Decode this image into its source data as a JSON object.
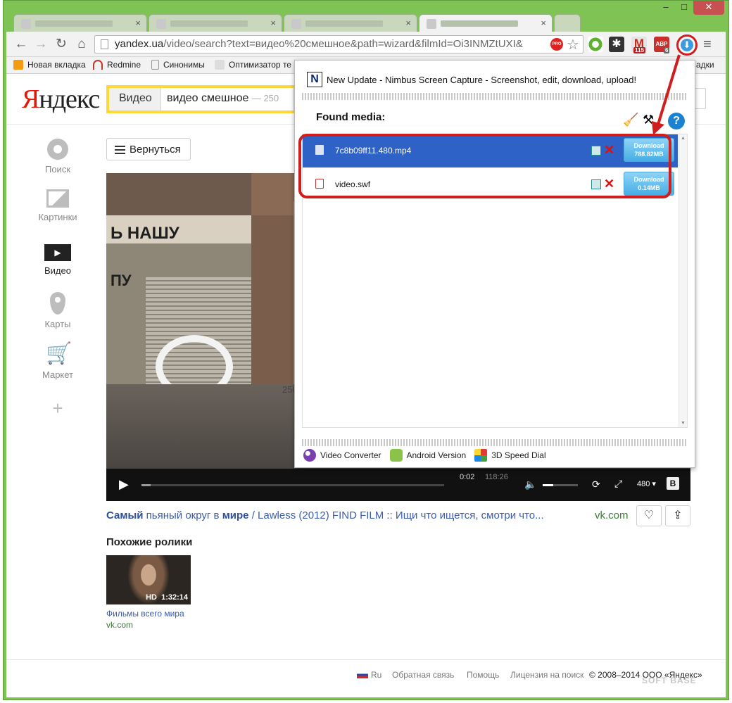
{
  "browser": {
    "omnibox": {
      "host": "yandex.ua",
      "path": "/video/search?text=видео%20смешное&path=wizard&filmId=Oi3INMZtUXI&"
    },
    "pro_badge": "PRO",
    "ext_badges": {
      "gmail": "115",
      "abp": "ABP",
      "abp_count": "6"
    },
    "bookmarks": [
      {
        "label": "Новая вкладка",
        "icon": "tab-icon"
      },
      {
        "label": "Redmine",
        "icon": "redmine-icon"
      },
      {
        "label": "Синонимы",
        "icon": "page-icon"
      },
      {
        "label": "Оптимизатор те",
        "icon": "seo-icon"
      }
    ],
    "bookmarks_overflow": "адки"
  },
  "yandex": {
    "logo_first": "Я",
    "logo_rest": "ндекс",
    "search_category": "Видео",
    "search_query": "видео смешное",
    "search_count": "— 250",
    "nav": [
      {
        "label": "Поиск",
        "icon": "search-circle-icon"
      },
      {
        "label": "Картинки",
        "icon": "pictures-icon"
      },
      {
        "label": "Видео",
        "icon": "video-play-icon"
      },
      {
        "label": "Карты",
        "icon": "map-pin-icon"
      },
      {
        "label": "Маркет",
        "icon": "cart-icon"
      }
    ],
    "nav_add": "+",
    "back_button": "Вернуться",
    "player": {
      "sign_text": "Ь НАШУ",
      "sign_text2": "ПУ",
      "sign_side": "250 ты",
      "time_current": "0:02",
      "time_total": "118:26",
      "quality": "480 ▾",
      "vk_badge": "B"
    },
    "video_title_parts": [
      {
        "text": "Самый",
        "bold": true
      },
      {
        "text": " пьяный округ в ",
        "bold": false
      },
      {
        "text": "мире",
        "bold": true
      },
      {
        "text": " / Lawless (2012) FIND FILM :: Ищи что ищется, смотри что...",
        "bold": false
      }
    ],
    "video_source": "vk.com",
    "similar_heading": "Похожие ролики",
    "similar": [
      {
        "hd": "HD",
        "duration": "1:32:14",
        "title": "Фильмы всего мира",
        "source": "vk.com"
      }
    ],
    "footer": {
      "lang": "Ru",
      "feedback": "Обратная связь",
      "help": "Помощь",
      "license": "Лицензия на поиск",
      "copyright": "© 2008–2014  ООО «Яндекс»"
    }
  },
  "popup": {
    "update_text": "New Update - Nimbus Screen Capture - Screenshot, edit, download, upload!",
    "found_label": "Found media:",
    "help_label": "?",
    "items": [
      {
        "name": "7c8b09ff11.480.mp4",
        "download": "Download",
        "size": "788.82MB",
        "selected": true
      },
      {
        "name": "video.swf",
        "download": "Download",
        "size": "0.14MB",
        "selected": false
      }
    ],
    "footer_links": [
      {
        "label": "Video Converter",
        "icon": "video-converter-icon"
      },
      {
        "label": "Android Version",
        "icon": "android-icon"
      },
      {
        "label": "3D Speed Dial",
        "icon": "speed-dial-icon"
      }
    ]
  },
  "watermark": "SOFT BASE",
  "colors": {
    "frame": "#7fc354",
    "highlight": "#d01d1d",
    "selected_row": "#2e62c6",
    "yandex_red": "#e61400",
    "search_border": "#ffd93a"
  }
}
